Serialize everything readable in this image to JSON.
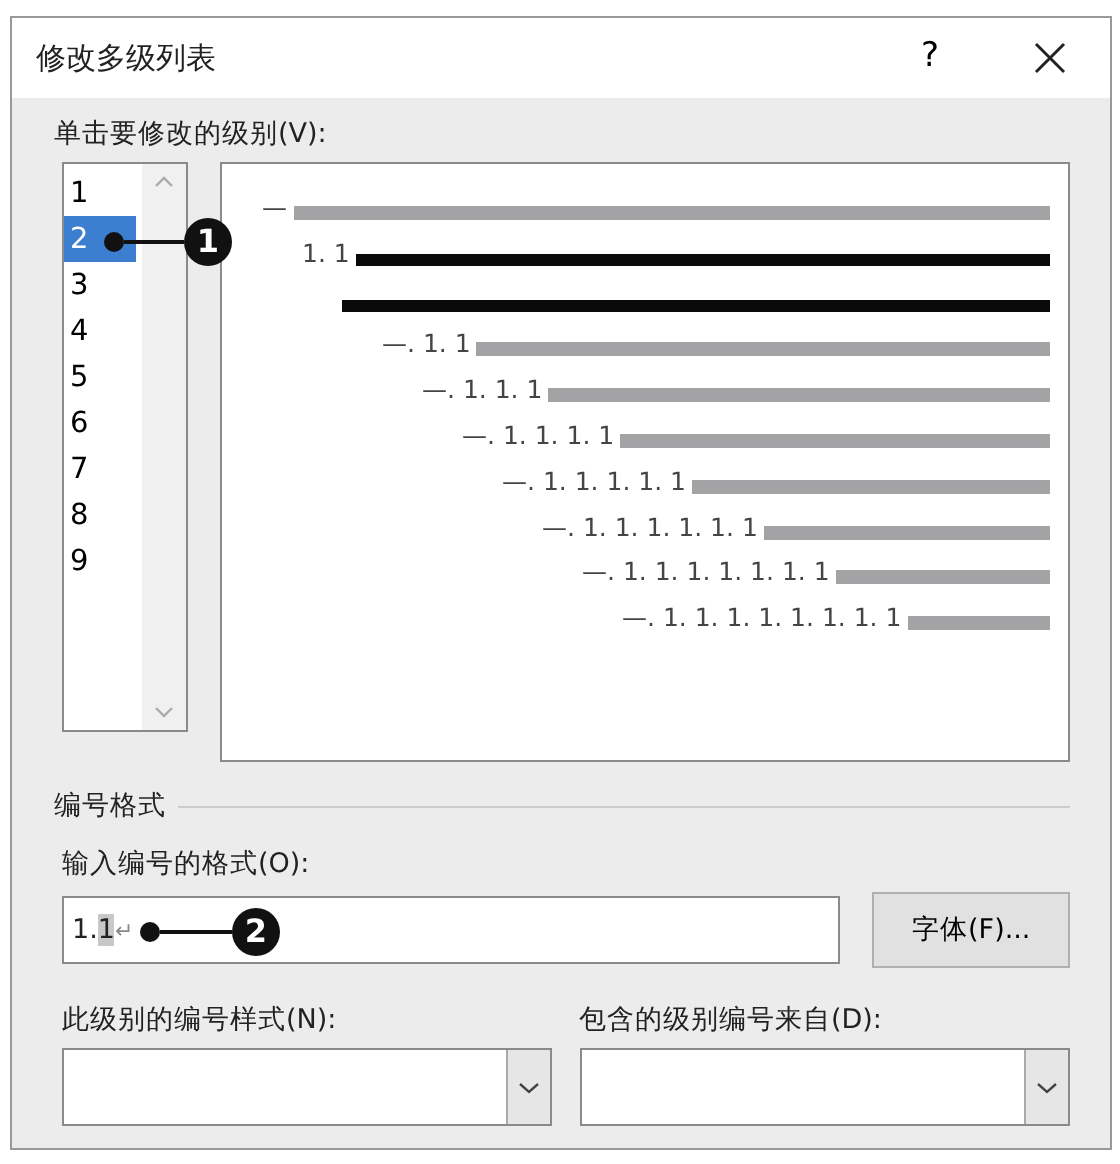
{
  "window": {
    "title": "修改多级列表",
    "help": "?"
  },
  "level_picker": {
    "label": "单击要修改的级别(V):",
    "levels": [
      {
        "label": "1",
        "selected": false
      },
      {
        "label": "2",
        "selected": true
      },
      {
        "label": "3",
        "selected": false
      },
      {
        "label": "4",
        "selected": false
      },
      {
        "label": "5",
        "selected": false
      },
      {
        "label": "6",
        "selected": false
      },
      {
        "label": "7",
        "selected": false
      },
      {
        "label": "8",
        "selected": false
      },
      {
        "label": "9",
        "selected": false
      }
    ],
    "callout": "1"
  },
  "preview": [
    {
      "text": "—",
      "highlighted": false
    },
    {
      "text": "1. 1",
      "highlighted": true
    },
    {
      "highlighted": true
    },
    {
      "text": "—. 1. 1",
      "highlighted": false
    },
    {
      "text": "—. 1. 1. 1",
      "highlighted": false
    },
    {
      "text": "—. 1. 1. 1. 1",
      "highlighted": false
    },
    {
      "text": "—. 1. 1. 1. 1. 1",
      "highlighted": false
    },
    {
      "text": "—. 1. 1. 1. 1. 1. 1",
      "highlighted": false
    },
    {
      "text": "—. 1. 1. 1. 1. 1. 1. 1",
      "highlighted": false
    },
    {
      "text": "—. 1. 1. 1. 1. 1. 1. 1. 1",
      "highlighted": false
    }
  ],
  "number_format": {
    "section": "编号格式",
    "format_label": "输入编号的格式(O):",
    "format_value": {
      "text": "1.",
      "field": "1",
      "end_mark": "↵"
    },
    "callout": "2",
    "font_button": "字体(F)...",
    "style_label": "此级别的编号样式(N):",
    "source_label": "包含的级别编号来自(D):"
  }
}
